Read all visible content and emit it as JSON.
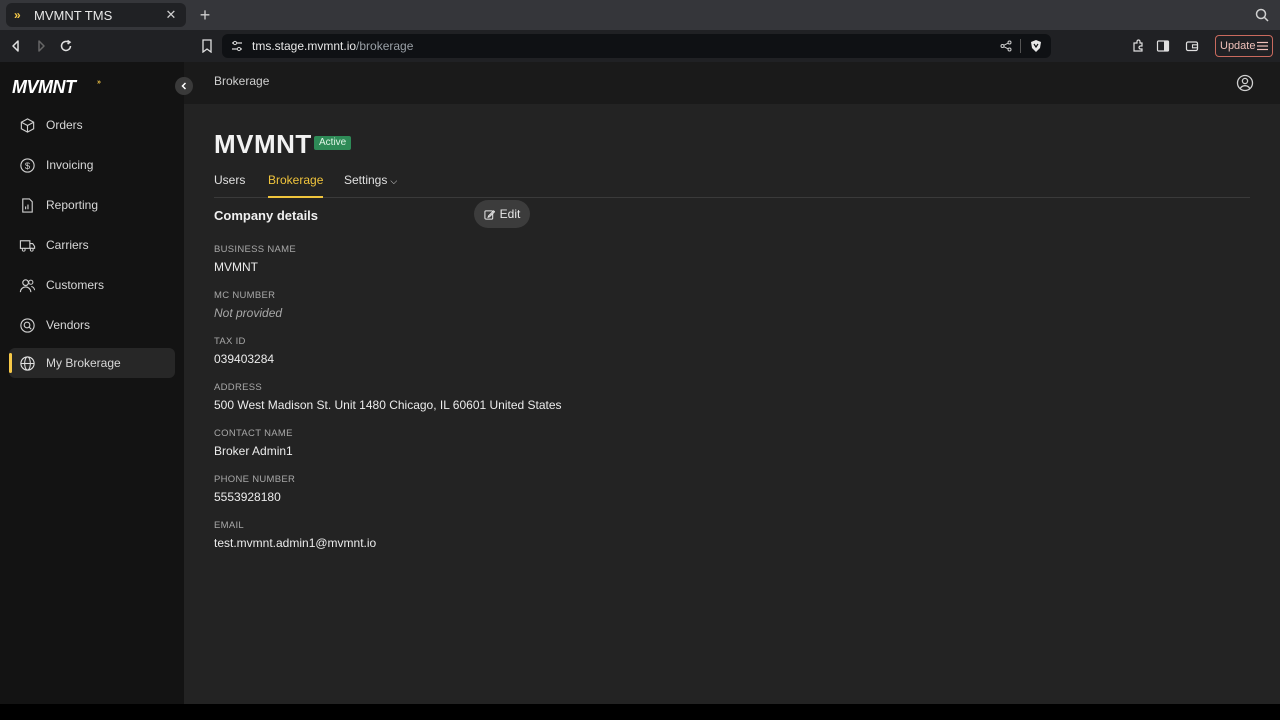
{
  "browser": {
    "tab_title": "MVMNT TMS",
    "tab_favicon": "»",
    "url_host": "tms.stage.mvmnt.io",
    "url_path": "/brokerage",
    "update_label": "Update"
  },
  "sidebar": {
    "logo": "MVMNT",
    "items": [
      {
        "label": "Orders",
        "icon": "box-icon"
      },
      {
        "label": "Invoicing",
        "icon": "dollar-icon"
      },
      {
        "label": "Reporting",
        "icon": "report-icon"
      },
      {
        "label": "Carriers",
        "icon": "truck-icon"
      },
      {
        "label": "Customers",
        "icon": "users-icon"
      },
      {
        "label": "Vendors",
        "icon": "vendor-icon"
      },
      {
        "label": "My Brokerage",
        "icon": "globe-icon",
        "active": true
      }
    ]
  },
  "header": {
    "breadcrumb": "Brokerage"
  },
  "page": {
    "title": "MVMNT",
    "status": "Active",
    "tabs": [
      {
        "label": "Users"
      },
      {
        "label": "Brokerage",
        "active": true
      },
      {
        "label": "Settings"
      }
    ],
    "section_title": "Company details",
    "edit_label": "Edit",
    "fields": [
      {
        "label": "BUSINESS NAME",
        "value": "MVMNT"
      },
      {
        "label": "MC NUMBER",
        "value": "Not provided"
      },
      {
        "label": "TAX ID",
        "value": "039403284"
      },
      {
        "label": "ADDRESS",
        "value": "500 West Madison St. Unit 1480 Chicago, IL 60601 United States"
      },
      {
        "label": "CONTACT NAME",
        "value": "Broker Admin1"
      },
      {
        "label": "PHONE NUMBER",
        "value": "5553928180"
      },
      {
        "label": "EMAIL",
        "value": "test.mvmnt.admin1@mvmnt.io"
      }
    ]
  },
  "colors": {
    "accent": "#f0c43c",
    "status_green": "#2e8b57",
    "sidebar_bg": "#131313",
    "main_bg": "#232323"
  }
}
